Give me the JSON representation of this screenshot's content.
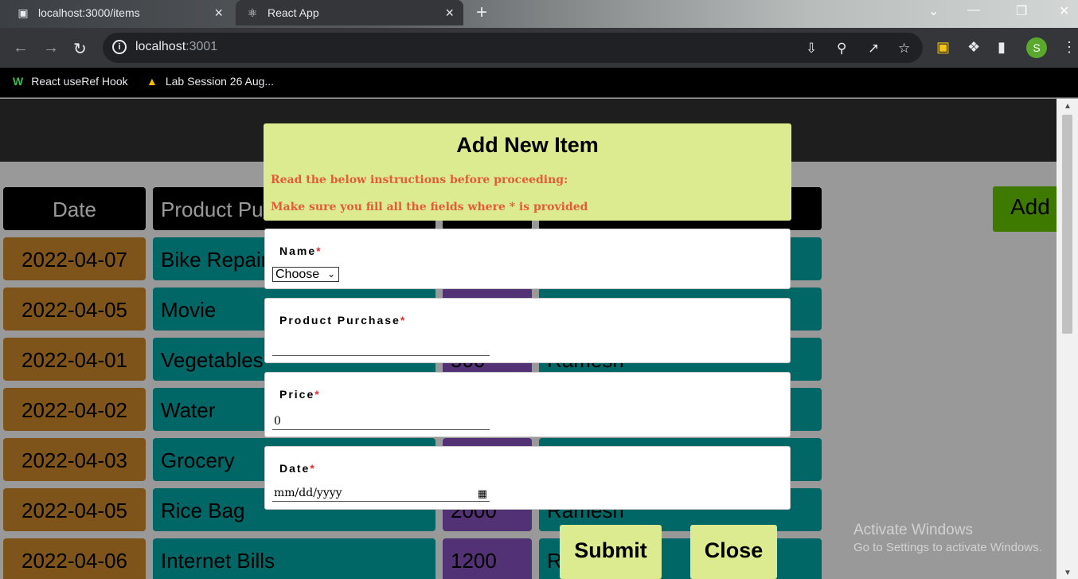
{
  "browser": {
    "tabs": [
      {
        "title": "localhost:3000/items",
        "active": false
      },
      {
        "title": "React App",
        "active": true
      }
    ],
    "url": {
      "host": "localhost",
      "port": ":3001"
    },
    "bookmarks": [
      {
        "label": "React useRef Hook"
      },
      {
        "label": "Lab Session 26 Aug..."
      }
    ],
    "profile_initial": "S"
  },
  "page": {
    "add_button_label": "Add",
    "table": {
      "headers": [
        "Date",
        "Product Pu",
        "",
        ""
      ],
      "rows": [
        {
          "date": "2022-04-07",
          "product": "Bike Repair",
          "price": "",
          "name": ""
        },
        {
          "date": "2022-04-05",
          "product": "Movie",
          "price": "",
          "name": ""
        },
        {
          "date": "2022-04-01",
          "product": "Vegetables",
          "price": "500",
          "name": "Ramesh"
        },
        {
          "date": "2022-04-02",
          "product": "Water",
          "price": "",
          "name": ""
        },
        {
          "date": "2022-04-03",
          "product": "Grocery",
          "price": "",
          "name": ""
        },
        {
          "date": "2022-04-05",
          "product": "Rice Bag",
          "price": "2000",
          "name": "Ramesh"
        },
        {
          "date": "2022-04-06",
          "product": "Internet Bills",
          "price": "1200",
          "name": "R"
        }
      ]
    }
  },
  "modal": {
    "title": "Add New Item",
    "instruction_1": "Read the below instructions before proceeding:",
    "instruction_2": "Make sure you fill all the fields where * is provided",
    "fields": {
      "name": {
        "label": "Name",
        "required_mark": "*",
        "selected": "Choose"
      },
      "product": {
        "label": "Product Purchase",
        "required_mark": "*",
        "value": ""
      },
      "price": {
        "label": "Price",
        "required_mark": "*",
        "value": "0"
      },
      "date": {
        "label": "Date",
        "required_mark": "*",
        "placeholder": "mm/dd/yyyy"
      }
    },
    "submit_label": "Submit",
    "close_label": "Close"
  },
  "os_watermark": {
    "line1": "Activate Windows",
    "line2": "Go to Settings to activate Windows."
  },
  "colors": {
    "modal_bg": "#dcea90",
    "instruction_text": "#e45b3a",
    "date_cell": "#d38d2e",
    "teal_cell": "#00aaaa",
    "purple_cell": "#8b52c4",
    "add_button": "#6acc00"
  }
}
